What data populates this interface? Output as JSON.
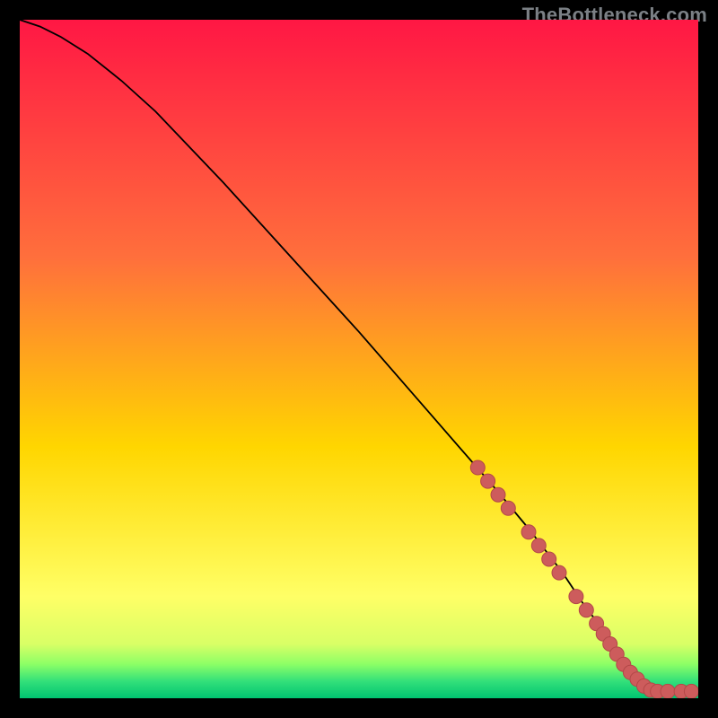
{
  "watermark": "TheBottleneck.com",
  "colors": {
    "gradient_top": "#ff1744",
    "gradient_mid_upper": "#ff6f3c",
    "gradient_mid": "#ffd600",
    "gradient_mid_lower": "#ffff66",
    "gradient_green1": "#d9ff66",
    "gradient_green2": "#8cff66",
    "gradient_green3": "#33e07a",
    "gradient_bottom": "#00c471",
    "curve": "#000000",
    "dot_fill": "#cd5c5c",
    "dot_stroke": "#b34848",
    "frame": "#000000"
  },
  "chart_data": {
    "type": "line",
    "title": "",
    "xlabel": "",
    "ylabel": "",
    "xlim": [
      0,
      100
    ],
    "ylim": [
      0,
      100
    ],
    "grid": false,
    "legend": false,
    "series": [
      {
        "name": "curve",
        "x": [
          0,
          3,
          6,
          10,
          15,
          20,
          30,
          40,
          50,
          60,
          70,
          75,
          80,
          83,
          86,
          88,
          90,
          92,
          95,
          100
        ],
        "y": [
          100,
          99,
          97.5,
          95,
          91,
          86.5,
          76,
          65,
          54,
          42.5,
          31,
          25,
          18.5,
          14,
          10,
          7,
          4.5,
          2.5,
          1,
          1
        ]
      }
    ],
    "points": [
      {
        "x": 67.5,
        "y": 34
      },
      {
        "x": 69,
        "y": 32
      },
      {
        "x": 70.5,
        "y": 30
      },
      {
        "x": 72,
        "y": 28
      },
      {
        "x": 75,
        "y": 24.5
      },
      {
        "x": 76.5,
        "y": 22.5
      },
      {
        "x": 78,
        "y": 20.5
      },
      {
        "x": 79.5,
        "y": 18.5
      },
      {
        "x": 82,
        "y": 15
      },
      {
        "x": 83.5,
        "y": 13
      },
      {
        "x": 85,
        "y": 11
      },
      {
        "x": 86,
        "y": 9.5
      },
      {
        "x": 87,
        "y": 8
      },
      {
        "x": 88,
        "y": 6.5
      },
      {
        "x": 89,
        "y": 5
      },
      {
        "x": 90,
        "y": 3.8
      },
      {
        "x": 91,
        "y": 2.8
      },
      {
        "x": 92,
        "y": 1.8
      },
      {
        "x": 93,
        "y": 1.2
      },
      {
        "x": 94,
        "y": 1
      },
      {
        "x": 95.5,
        "y": 1
      },
      {
        "x": 97.5,
        "y": 1
      },
      {
        "x": 99,
        "y": 1
      }
    ],
    "dot_radius_px": 8
  }
}
